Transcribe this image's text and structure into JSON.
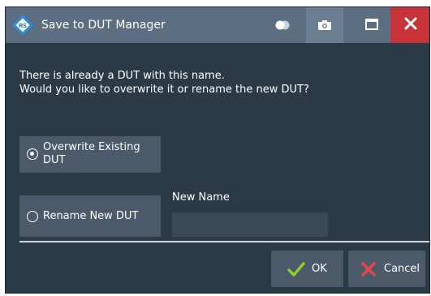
{
  "window": {
    "title": "Save to DUT Manager"
  },
  "message": {
    "line1": "There is already a DUT with this name.",
    "line2": "Would you like to overwrite it or rename the new DUT?"
  },
  "options": {
    "overwrite_label": "Overwrite Existing DUT",
    "rename_label": "Rename New DUT",
    "selected": "overwrite"
  },
  "new_name": {
    "label": "New Name",
    "value": ""
  },
  "buttons": {
    "ok_label": "OK",
    "cancel_label": "Cancel"
  },
  "colors": {
    "dialog_bg": "#2b3a47",
    "titlebar_bg": "#5c6f82",
    "button_bg": "#4a5a6a",
    "close_bg": "#c8333a",
    "ok_check": "#8ad12c",
    "cancel_x": "#e8454d"
  },
  "icons": {
    "logo": "rohde-schwarz-logo-icon",
    "toggle": "toggle-icon",
    "camera": "camera-icon",
    "maximize": "maximize-icon",
    "close": "close-icon",
    "ok": "checkmark-icon",
    "cancel": "cross-icon"
  }
}
